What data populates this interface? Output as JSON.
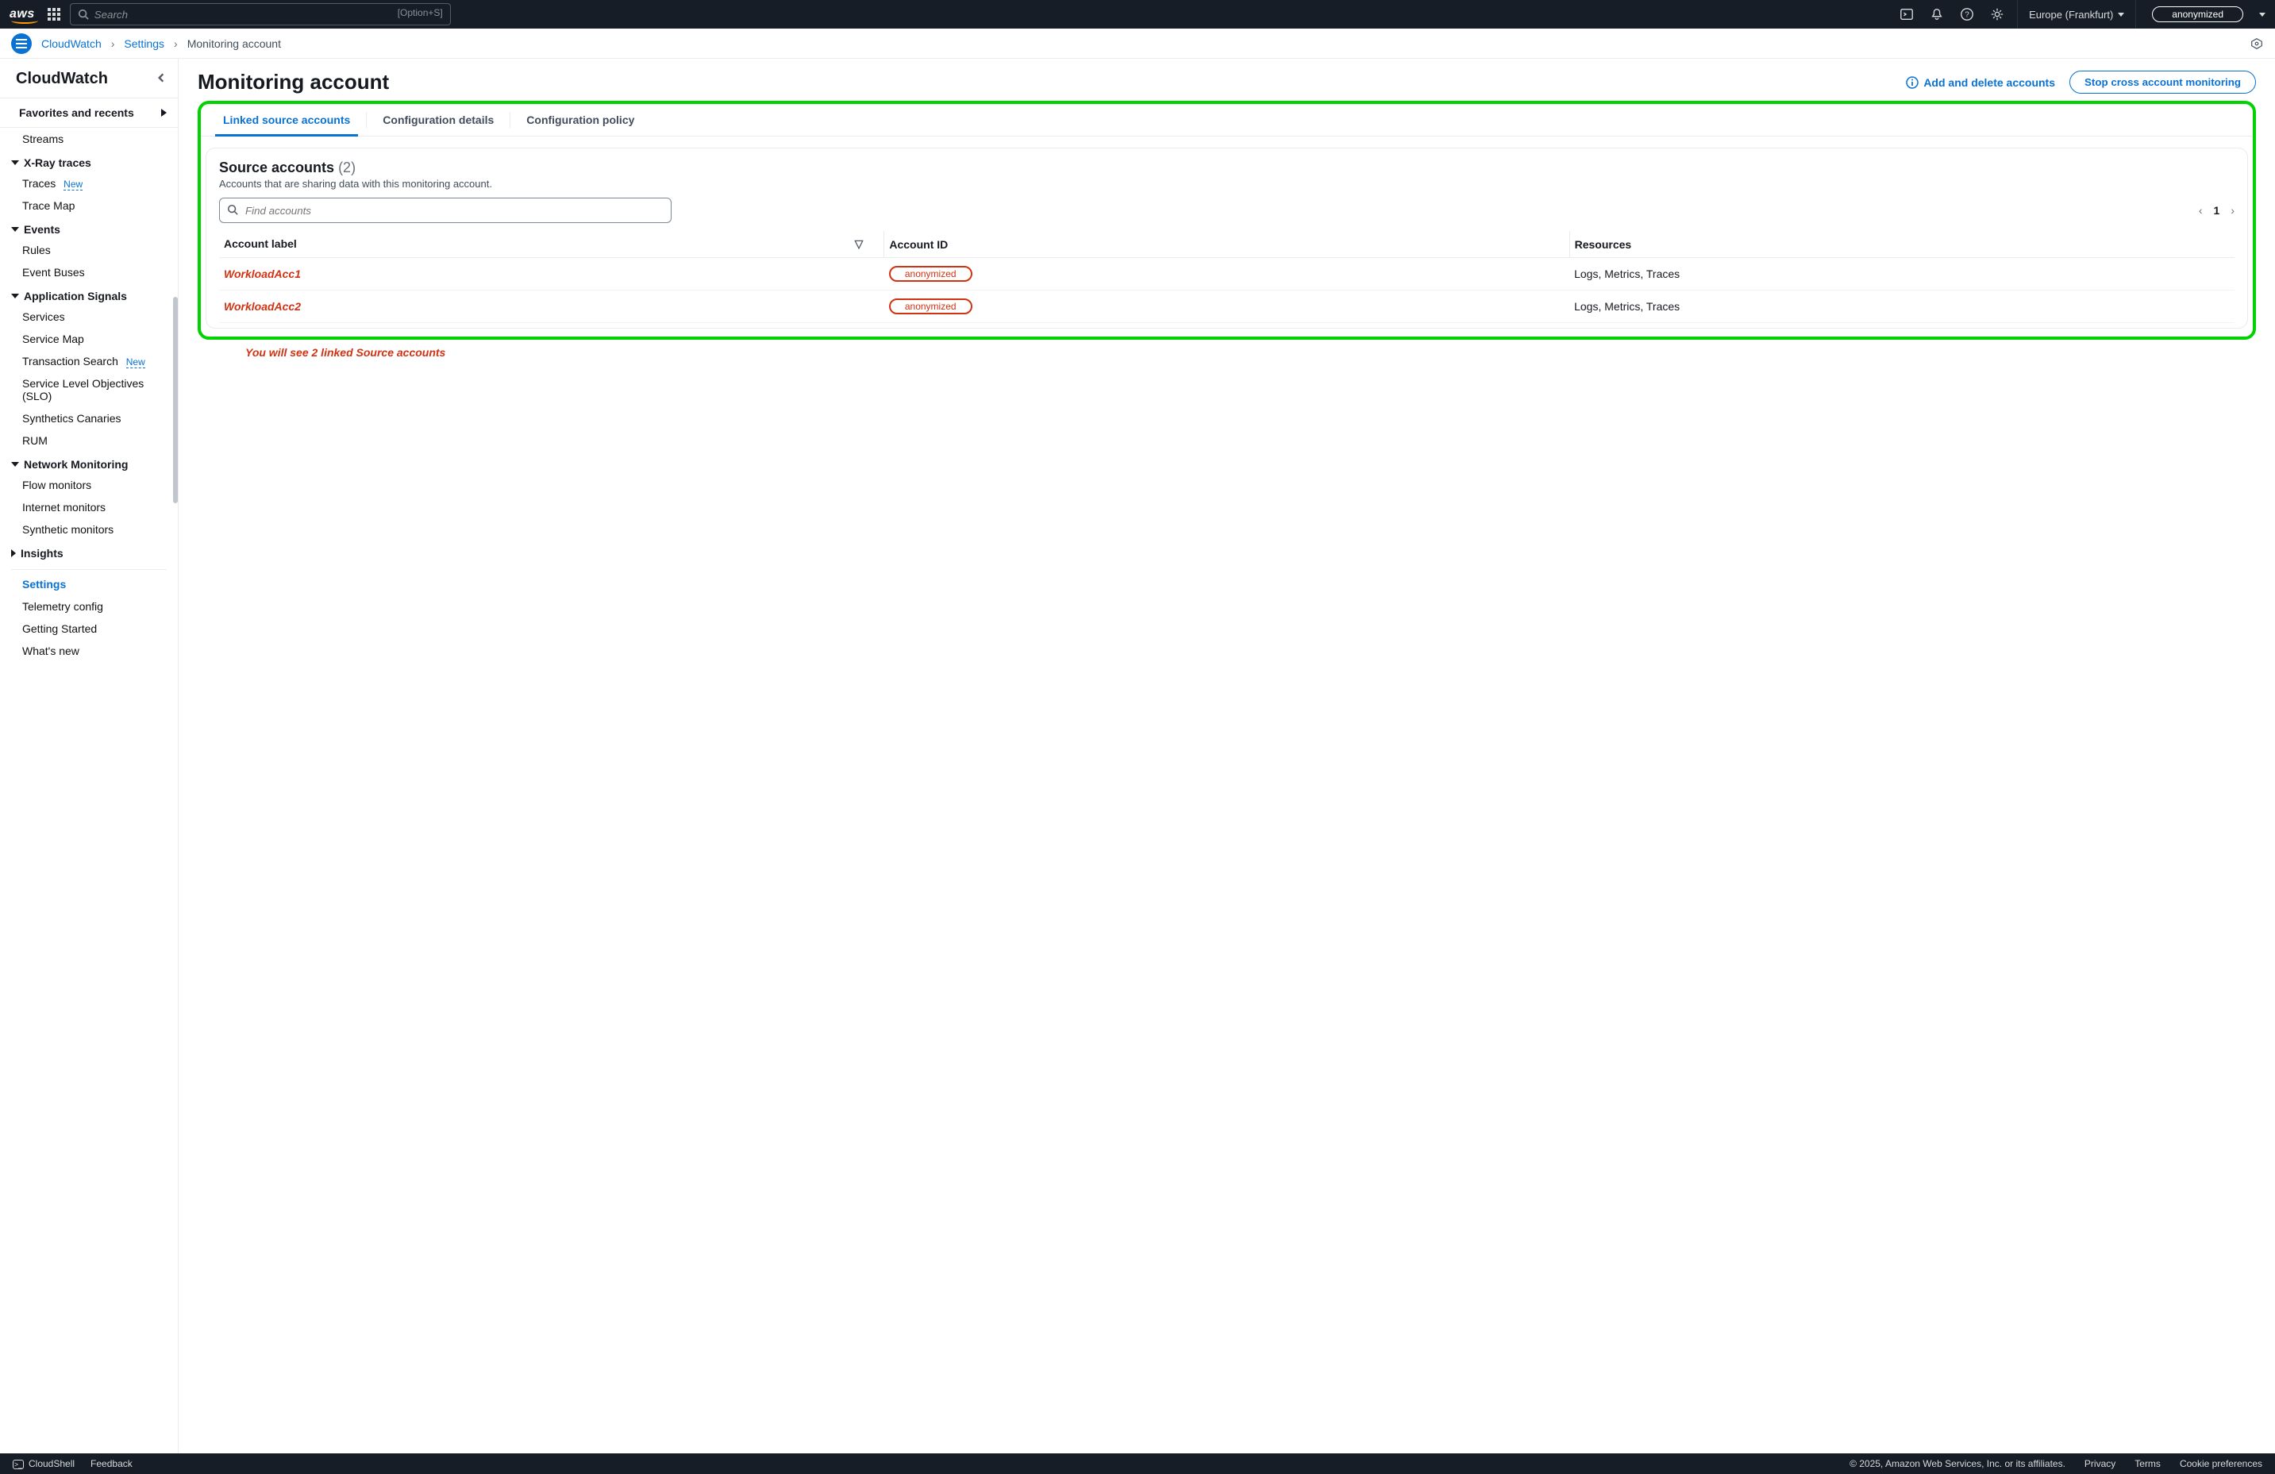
{
  "topnav": {
    "search_placeholder": "Search",
    "search_shortcut": "[Option+S]",
    "region": "Europe (Frankfurt)",
    "account_label": "anonymized"
  },
  "breadcrumb": {
    "items": [
      "CloudWatch",
      "Settings"
    ],
    "current": "Monitoring account"
  },
  "sidebar": {
    "title": "CloudWatch",
    "favorites_label": "Favorites and recents",
    "streams": "Streams",
    "groups": {
      "xray": {
        "label": "X-Ray traces",
        "items": [
          {
            "label": "Traces",
            "badge": "New"
          },
          {
            "label": "Trace Map"
          }
        ]
      },
      "events": {
        "label": "Events",
        "items": [
          {
            "label": "Rules"
          },
          {
            "label": "Event Buses"
          }
        ]
      },
      "appsignals": {
        "label": "Application Signals",
        "items": [
          {
            "label": "Services"
          },
          {
            "label": "Service Map"
          },
          {
            "label": "Transaction Search",
            "badge": "New"
          },
          {
            "label": "Service Level Objectives (SLO)"
          },
          {
            "label": "Synthetics Canaries"
          },
          {
            "label": "RUM"
          }
        ]
      },
      "netmon": {
        "label": "Network Monitoring",
        "items": [
          {
            "label": "Flow monitors"
          },
          {
            "label": "Internet monitors"
          },
          {
            "label": "Synthetic monitors"
          }
        ]
      },
      "insights": {
        "label": "Insights"
      }
    },
    "bottom": {
      "settings": "Settings",
      "telemetry": "Telemetry config",
      "getting_started": "Getting Started",
      "whats_new": "What's new"
    }
  },
  "page": {
    "title": "Monitoring account",
    "info_link": "Add and delete accounts",
    "stop_btn": "Stop cross account monitoring"
  },
  "tabs": {
    "linked": "Linked source accounts",
    "config_details": "Configuration details",
    "config_policy": "Configuration policy"
  },
  "panel": {
    "title": "Source accounts",
    "count": "(2)",
    "subtitle": "Accounts that are sharing data with this monitoring account.",
    "find_placeholder": "Find accounts",
    "page_number": "1",
    "columns": {
      "label": "Account label",
      "id": "Account ID",
      "resources": "Resources"
    },
    "rows": [
      {
        "label": "WorkloadAcc1",
        "id": "anonymized",
        "resources": "Logs, Metrics, Traces"
      },
      {
        "label": "WorkloadAcc2",
        "id": "anonymized",
        "resources": "Logs, Metrics, Traces"
      }
    ]
  },
  "annotation": "You will see 2 linked Source accounts",
  "footer": {
    "cloudshell": "CloudShell",
    "feedback": "Feedback",
    "copyright": "© 2025, Amazon Web Services, Inc. or its affiliates.",
    "privacy": "Privacy",
    "terms": "Terms",
    "cookies": "Cookie preferences"
  }
}
